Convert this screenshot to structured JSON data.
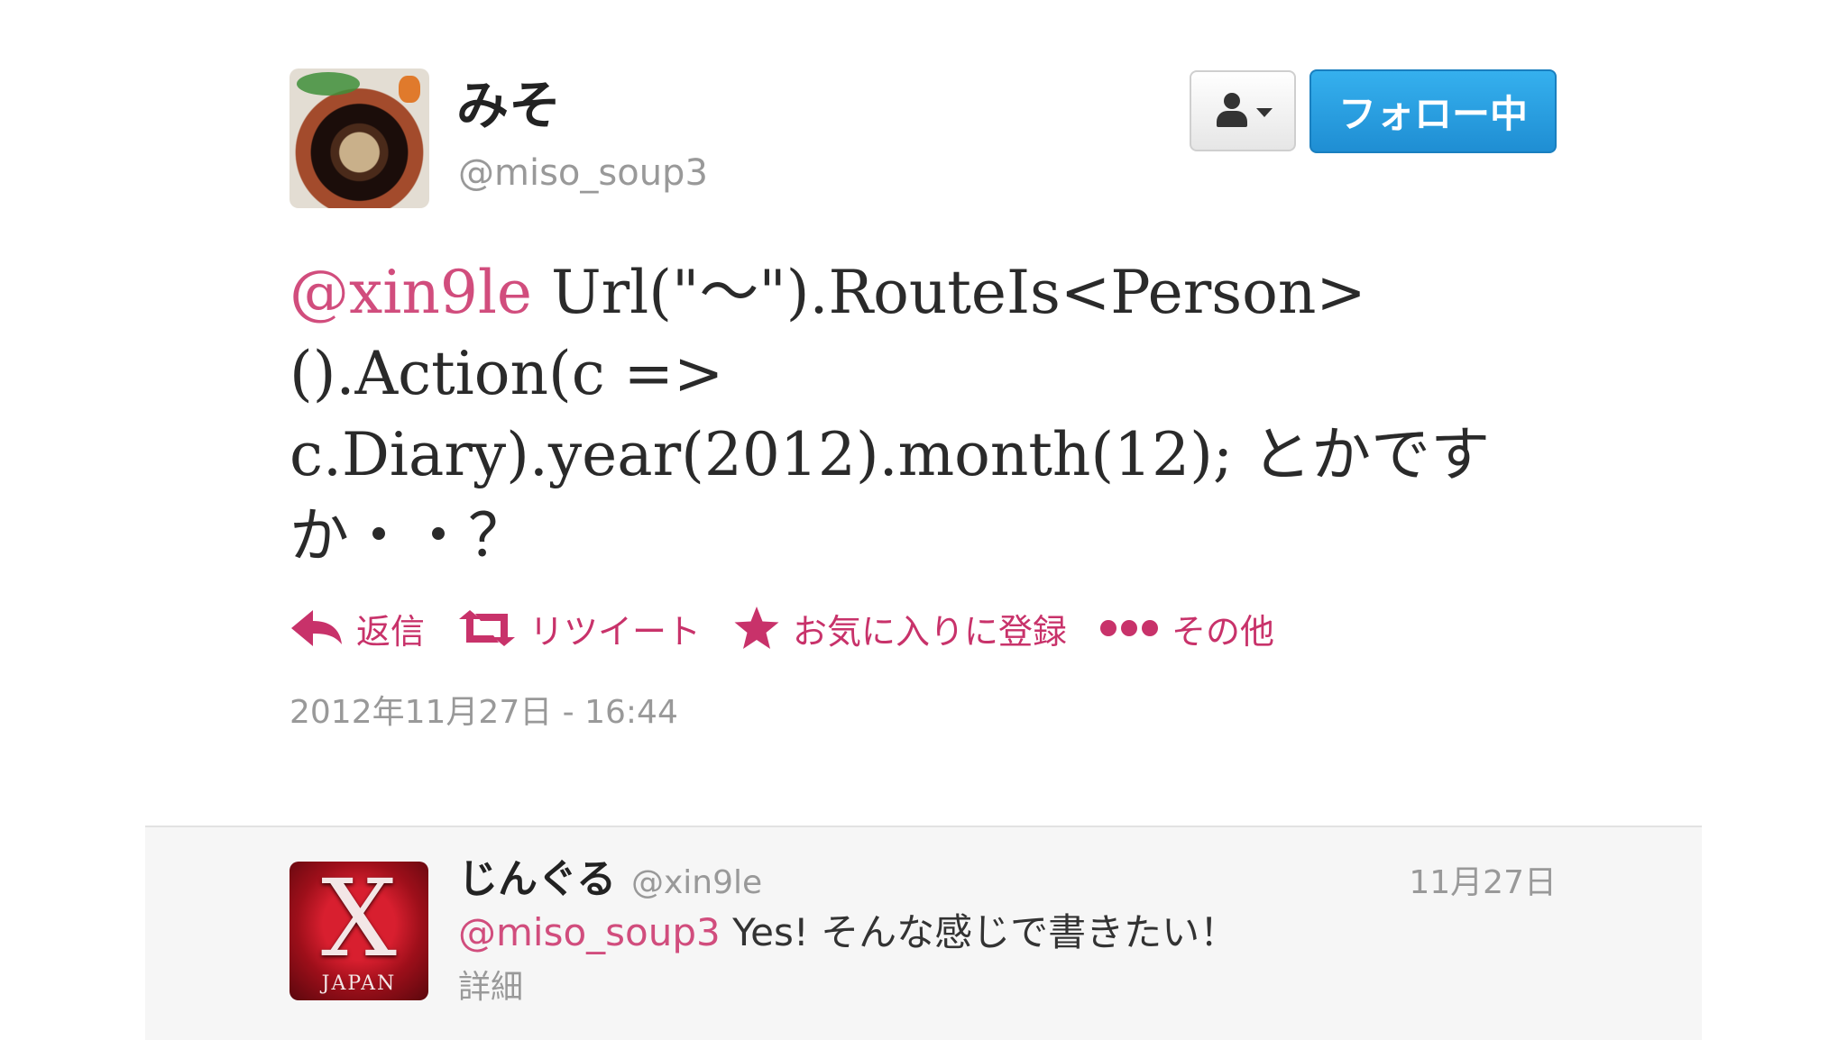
{
  "tweet": {
    "author": {
      "display_name": "みそ",
      "screen_name": "@miso_soup3"
    },
    "follow_button_label": "フォロー中",
    "text": {
      "mention": "@xin9le",
      "line1_rest": " Url(\"～\").RouteIs<Person>",
      "line2": "().Action(c =>",
      "line3": "c.Diary).year(2012).month(12); とかです",
      "line4": "か・・？"
    },
    "actions": {
      "reply": "返信",
      "retweet": "リツイート",
      "favorite": "お気に入りに登録",
      "more": "その他"
    },
    "timestamp": "2012年11月27日 - 16:44"
  },
  "reply": {
    "display_name": "じんぐる",
    "screen_name": "@xin9le",
    "date": "11月27日",
    "mention": "@miso_soup3",
    "text": " Yes! そんな感じで書きたい！",
    "details_link": "詳細",
    "avatar_logo_letter": "X",
    "avatar_logo_text": "JAPAN"
  },
  "colors": {
    "accent_pink": "#d14d7d",
    "action_pink": "#c8326a",
    "follow_blue": "#2aa1e3",
    "muted_gray": "#999999"
  },
  "icons": [
    "user-dropdown-icon",
    "reply-icon",
    "retweet-icon",
    "favorite-star-icon",
    "more-dots-icon"
  ]
}
